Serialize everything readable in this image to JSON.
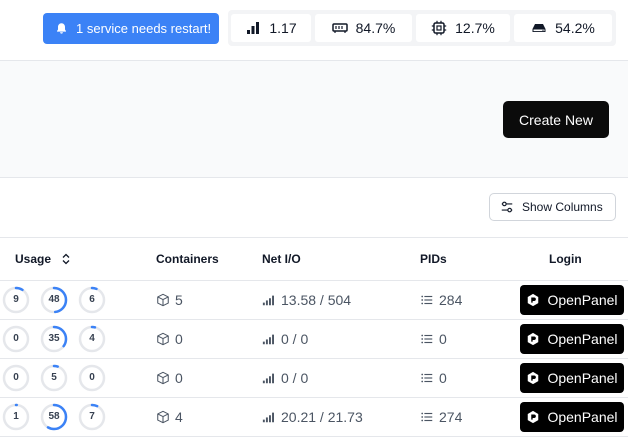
{
  "alert": {
    "text": "1 service needs restart!",
    "icon": "bell-icon"
  },
  "stats": [
    {
      "name": "load",
      "value": "1.17",
      "icon": "bar-chart-icon"
    },
    {
      "name": "memory",
      "value": "84.7%",
      "icon": "memory-icon"
    },
    {
      "name": "cpu",
      "value": "12.7%",
      "icon": "cpu-icon"
    },
    {
      "name": "disk",
      "value": "54.2%",
      "icon": "hard-drive-icon"
    }
  ],
  "toolbar": {
    "create_label": "Create New",
    "columns_label": "Show Columns"
  },
  "table": {
    "headers": {
      "usage": "Usage",
      "containers": "Containers",
      "netio": "Net I/O",
      "pids": "PIDs",
      "login": "Login"
    },
    "rows": [
      {
        "usage": [
          "9",
          "48",
          "6"
        ],
        "usage_pct": [
          9,
          48,
          6
        ],
        "containers": "5",
        "netio": "13.58 / 504",
        "pids": "284",
        "login": "OpenPanel"
      },
      {
        "usage": [
          "0",
          "35",
          "4"
        ],
        "usage_pct": [
          0,
          35,
          4
        ],
        "containers": "0",
        "netio": "0 / 0",
        "pids": "0",
        "login": "OpenPanel"
      },
      {
        "usage": [
          "0",
          "5",
          "0"
        ],
        "usage_pct": [
          0,
          5,
          0
        ],
        "containers": "0",
        "netio": "0 / 0",
        "pids": "0",
        "login": "OpenPanel"
      },
      {
        "usage": [
          "1",
          "58",
          "7"
        ],
        "usage_pct": [
          1,
          58,
          7
        ],
        "containers": "4",
        "netio": "20.21 / 21.73",
        "pids": "274",
        "login": "OpenPanel"
      }
    ]
  },
  "colors": {
    "accent": "#3b82f6",
    "ring_track": "#e5e7eb",
    "button_dark": "#000000"
  }
}
